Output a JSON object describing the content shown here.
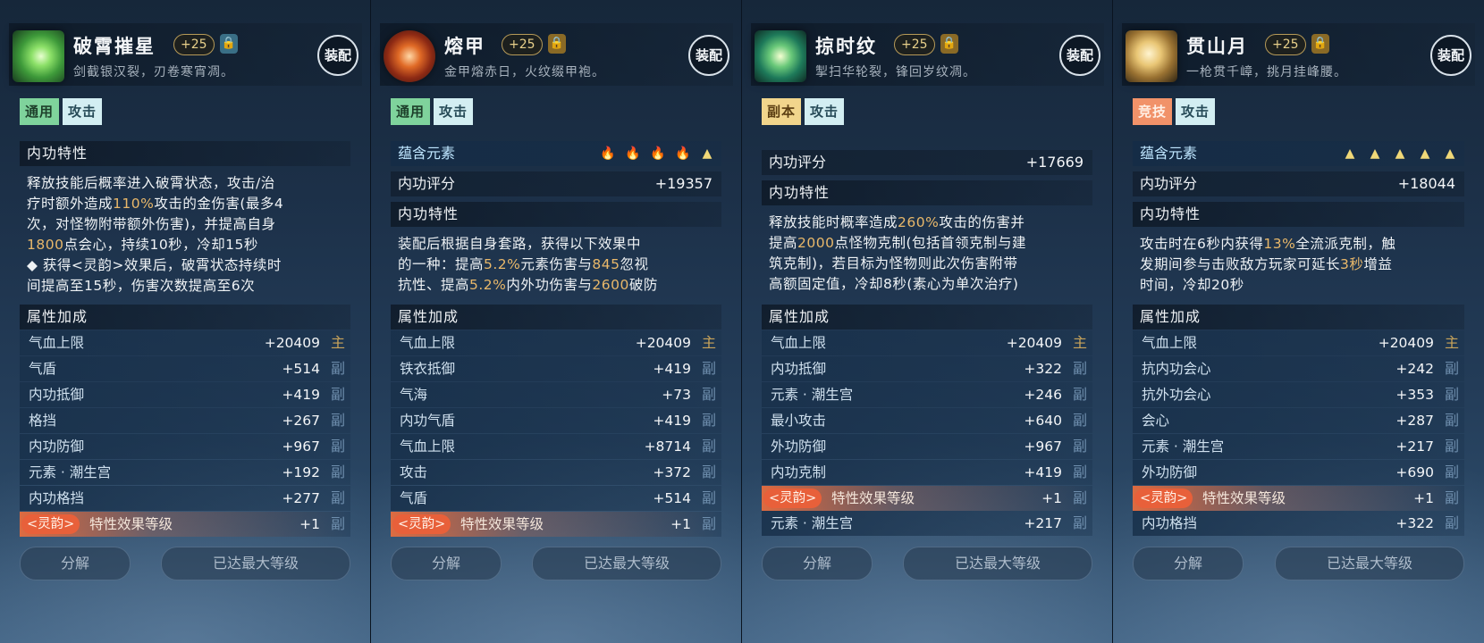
{
  "panels": [
    {
      "icon": "green-blade-icon",
      "name": "破霄摧星",
      "level": "+25",
      "lock": "unlocked",
      "desc": "剑截银汉裂，刃卷寒宵凋。",
      "equip": "装配",
      "tags": [
        {
          "text": "通用",
          "color": "#7fd39c"
        },
        {
          "text": "攻击",
          "color": "#d3eef2"
        }
      ],
      "elements": null,
      "score": null,
      "trait_title": "内功特性",
      "trait_lines": [
        [
          {
            "t": "释放技能后概率进入破霄状态，攻击/治"
          }
        ],
        [
          {
            "t": "疗时额外造成"
          },
          {
            "t": "110%",
            "h": true
          },
          {
            "t": "攻击的金伤害(最多4"
          }
        ],
        [
          {
            "t": "次，对怪物附带额外伤害)，并提高自身"
          }
        ],
        [
          {
            "t": "1800",
            "h": true
          },
          {
            "t": "点会心，持续10秒，冷却15秒"
          }
        ],
        [
          {
            "t": "◆ 获得<灵韵>效果后，破霄状态持续时"
          }
        ],
        [
          {
            "t": "间提高至15秒，伤害次数提高至6次"
          }
        ]
      ],
      "attr_title": "属性加成",
      "attrs": [
        {
          "name": "气血上限",
          "value": "+20409",
          "mark": "主"
        },
        {
          "name": "气盾",
          "value": "+514",
          "mark": "副"
        },
        {
          "name": "内功抵御",
          "value": "+419",
          "mark": "副"
        },
        {
          "name": "格挡",
          "value": "+267",
          "mark": "副"
        },
        {
          "name": "内功防御",
          "value": "+967",
          "mark": "副"
        },
        {
          "name": "元素 · 潮生宫",
          "value": "+192",
          "mark": "副"
        },
        {
          "name": "内功格挡",
          "value": "+277",
          "mark": "副"
        }
      ],
      "soul": {
        "badge": "<灵韵>",
        "text": "特性效果等级",
        "value": "+1",
        "mark": "副"
      },
      "tail_attr": null,
      "btn_split": "分解",
      "btn_max": "已达最大等级"
    },
    {
      "icon": "fire-orb-icon",
      "name": "熔甲",
      "level": "+25",
      "lock": "locked",
      "desc": "金甲熔赤日，火纹缀甲袍。",
      "equip": "装配",
      "tags": [
        {
          "text": "通用",
          "color": "#7fd39c"
        },
        {
          "text": "攻击",
          "color": "#d3eef2"
        }
      ],
      "elements": {
        "label": "蕴含元素",
        "gems": [
          "fire",
          "fire",
          "fire",
          "fire",
          "gold"
        ]
      },
      "score": {
        "label": "内功评分",
        "value": "+19357"
      },
      "trait_title": "内功特性",
      "trait_lines": [
        [
          {
            "t": "装配后根据自身套路，获得以下效果中"
          }
        ],
        [
          {
            "t": "的一种：提高"
          },
          {
            "t": "5.2%",
            "h": true
          },
          {
            "t": "元素伤害与"
          },
          {
            "t": "845",
            "h": true
          },
          {
            "t": "忽视"
          }
        ],
        [
          {
            "t": "抗性、提高"
          },
          {
            "t": "5.2%",
            "h": true
          },
          {
            "t": "内外功伤害与"
          },
          {
            "t": "2600",
            "h": true
          },
          {
            "t": "破防"
          }
        ]
      ],
      "attr_title": "属性加成",
      "attrs": [
        {
          "name": "气血上限",
          "value": "+20409",
          "mark": "主"
        },
        {
          "name": "铁衣抵御",
          "value": "+419",
          "mark": "副"
        },
        {
          "name": "气海",
          "value": "+73",
          "mark": "副"
        },
        {
          "name": "内功气盾",
          "value": "+419",
          "mark": "副"
        },
        {
          "name": "气血上限",
          "value": "+8714",
          "mark": "副"
        },
        {
          "name": "攻击",
          "value": "+372",
          "mark": "副"
        },
        {
          "name": "气盾",
          "value": "+514",
          "mark": "副"
        }
      ],
      "soul": {
        "badge": "<灵韵>",
        "text": "特性效果等级",
        "value": "+1",
        "mark": "副"
      },
      "tail_attr": null,
      "btn_split": "分解",
      "btn_max": "已达最大等级"
    },
    {
      "icon": "green-leaf-icon",
      "name": "掠时纹",
      "level": "+25",
      "lock": "locked",
      "desc": "掣扫华轮裂，锋回岁纹凋。",
      "equip": "装配",
      "tags": [
        {
          "text": "副本",
          "color": "#f1d58c"
        },
        {
          "text": "攻击",
          "color": "#d3eef2"
        }
      ],
      "elements": null,
      "score": {
        "label": "内功评分",
        "value": "+17669"
      },
      "trait_title": "内功特性",
      "trait_lines": [
        [
          {
            "t": "释放技能时概率造成"
          },
          {
            "t": "260%",
            "h": true
          },
          {
            "t": "攻击的伤害并"
          }
        ],
        [
          {
            "t": "提高"
          },
          {
            "t": "2000",
            "h": true
          },
          {
            "t": "点怪物克制(包括首领克制与建"
          }
        ],
        [
          {
            "t": "筑克制)，若目标为怪物则此次伤害附带"
          }
        ],
        [
          {
            "t": "高额固定值，冷却8秒(素心为单次治疗)"
          }
        ]
      ],
      "attr_title": "属性加成",
      "attrs": [
        {
          "name": "气血上限",
          "value": "+20409",
          "mark": "主"
        },
        {
          "name": "内功抵御",
          "value": "+322",
          "mark": "副"
        },
        {
          "name": "元素 · 潮生宫",
          "value": "+246",
          "mark": "副"
        },
        {
          "name": "最小攻击",
          "value": "+640",
          "mark": "副"
        },
        {
          "name": "外功防御",
          "value": "+967",
          "mark": "副"
        },
        {
          "name": "内功克制",
          "value": "+419",
          "mark": "副"
        }
      ],
      "soul": {
        "badge": "<灵韵>",
        "text": "特性效果等级",
        "value": "+1",
        "mark": "副"
      },
      "tail_attr": {
        "name": "元素 · 潮生宫",
        "value": "+217",
        "mark": "副"
      },
      "btn_split": "分解",
      "btn_max": "已达最大等级"
    },
    {
      "icon": "gold-spears-icon",
      "name": "贯山月",
      "level": "+25",
      "lock": "locked",
      "desc": "一枪贯千嶂，挑月挂峰腰。",
      "equip": "装配",
      "tags": [
        {
          "text": "竞技",
          "color": "#f19269"
        },
        {
          "text": "攻击",
          "color": "#d3eef2"
        }
      ],
      "elements": {
        "label": "蕴含元素",
        "gems": [
          "gold",
          "gold",
          "gold",
          "gold",
          "gold"
        ]
      },
      "score": {
        "label": "内功评分",
        "value": "+18044"
      },
      "trait_title": "内功特性",
      "trait_lines": [
        [
          {
            "t": "攻击时在6秒内获得"
          },
          {
            "t": "13%",
            "h": true
          },
          {
            "t": "全流派克制，触"
          }
        ],
        [
          {
            "t": "发期间参与击败敌方玩家可延长"
          },
          {
            "t": "3秒",
            "h": true
          },
          {
            "t": "增益"
          }
        ],
        [
          {
            "t": "时间，冷却20秒"
          }
        ]
      ],
      "attr_title": "属性加成",
      "attrs": [
        {
          "name": "气血上限",
          "value": "+20409",
          "mark": "主"
        },
        {
          "name": "抗内功会心",
          "value": "+242",
          "mark": "副"
        },
        {
          "name": "抗外功会心",
          "value": "+353",
          "mark": "副"
        },
        {
          "name": "会心",
          "value": "+287",
          "mark": "副"
        },
        {
          "name": "元素 · 潮生宫",
          "value": "+217",
          "mark": "副"
        },
        {
          "name": "外功防御",
          "value": "+690",
          "mark": "副"
        }
      ],
      "soul": {
        "badge": "<灵韵>",
        "text": "特性效果等级",
        "value": "+1",
        "mark": "副"
      },
      "tail_attr": {
        "name": "内功格挡",
        "value": "+322",
        "mark": "副"
      },
      "btn_split": "分解",
      "btn_max": "已达最大等级"
    }
  ]
}
